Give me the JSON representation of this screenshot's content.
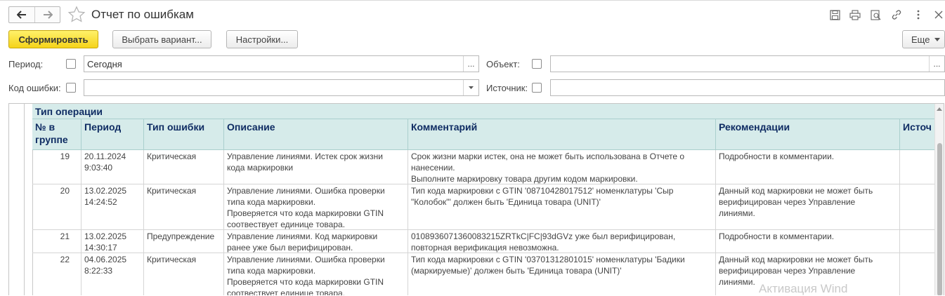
{
  "header": {
    "title": "Отчет по ошибкам",
    "back_icon": "arrow-left-icon",
    "forward_icon": "arrow-right-icon",
    "favorite_icon": "star-icon",
    "actions": [
      "save-icon",
      "print-icon",
      "preview-icon",
      "link-icon",
      "more-vertical-icon",
      "close-icon"
    ]
  },
  "toolbar": {
    "generate_label": "Сформировать",
    "choose_variant_label": "Выбрать вариант...",
    "settings_label": "Настройки...",
    "more_label": "Еще",
    "accent_color": "#f5d31a"
  },
  "filters": {
    "period_label": "Период:",
    "period_value": "Сегодня",
    "period_button": "...",
    "object_label": "Объект:",
    "object_value": "",
    "object_button": "...",
    "error_code_label": "Код ошибки:",
    "error_code_value": "",
    "source_label": "Источник:",
    "source_value": ""
  },
  "report": {
    "group_header": "Тип операции",
    "columns": [
      {
        "line1": "№ в",
        "line2": "группе"
      },
      {
        "line1": "Период",
        "line2": ""
      },
      {
        "line1": "Тип ошибки",
        "line2": ""
      },
      {
        "line1": "Описание",
        "line2": ""
      },
      {
        "line1": "Комментарий",
        "line2": ""
      },
      {
        "line1": "Рекомендации",
        "line2": ""
      },
      {
        "line1": "Источ",
        "line2": ""
      }
    ],
    "header_color": "#d6ebea",
    "header_text_color": "#0f2c63",
    "rows": [
      {
        "num": "19",
        "period": [
          "20.11.2024",
          "9:03:40"
        ],
        "type": "Критическая",
        "description": [
          "Управление линиями. Истек срок жизни",
          "кода маркировки"
        ],
        "comment": [
          "Срок жизни марки истек, она не может быть использована в Отчете о",
          "нанесении.",
          "Выполните маркировку товара другим кодом маркировки."
        ],
        "recommendation": [
          "Подробности в комментарии."
        ]
      },
      {
        "num": "20",
        "period": [
          "13.02.2025",
          "14:24:52"
        ],
        "type": "Критическая",
        "description": [
          "Управление линиями. Ошибка проверки",
          "типа кода маркировки.",
          "Проверяется что кода маркировки GTIN",
          "соотвествует единице товара."
        ],
        "comment": [
          "Тип кода маркировки с GTIN '08710428017512' номенклатуры 'Сыр",
          "\"Колобок\"' должен быть 'Единица товара (UNIT)'"
        ],
        "recommendation": [
          "Данный код маркировки не может быть",
          "верифицирован через Управление",
          "линиями."
        ]
      },
      {
        "num": "21",
        "period": [
          "13.02.2025",
          "14:30:17"
        ],
        "type": "Предупреждение",
        "description": [
          "Управление линиями. Код маркировки",
          "ранее уже был верифицирован."
        ],
        "comment": [
          "0108936071360083215ZRTkC|FC|93dGVz уже был верифицирован,",
          "повторная верификация невозможна."
        ],
        "recommendation": [
          "Подробности в комментарии."
        ]
      },
      {
        "num": "22",
        "period": [
          "04.06.2025",
          "8:22:33"
        ],
        "type": "Критическая",
        "description": [
          "Управление линиями. Ошибка проверки",
          "типа кода маркировки.",
          "Проверяется что кода маркировки GTIN",
          "соотвествует единице товара."
        ],
        "comment": [
          "Тип кода маркировки с GTIN '03701312801015' номенклатуры 'Бадики",
          "(маркируемые)' должен быть 'Единица товара (UNIT)'"
        ],
        "recommendation": [
          "Данный код маркировки не может быть",
          "верифицирован через Управление",
          "линиями."
        ]
      }
    ]
  },
  "watermark": "Активация Wind"
}
